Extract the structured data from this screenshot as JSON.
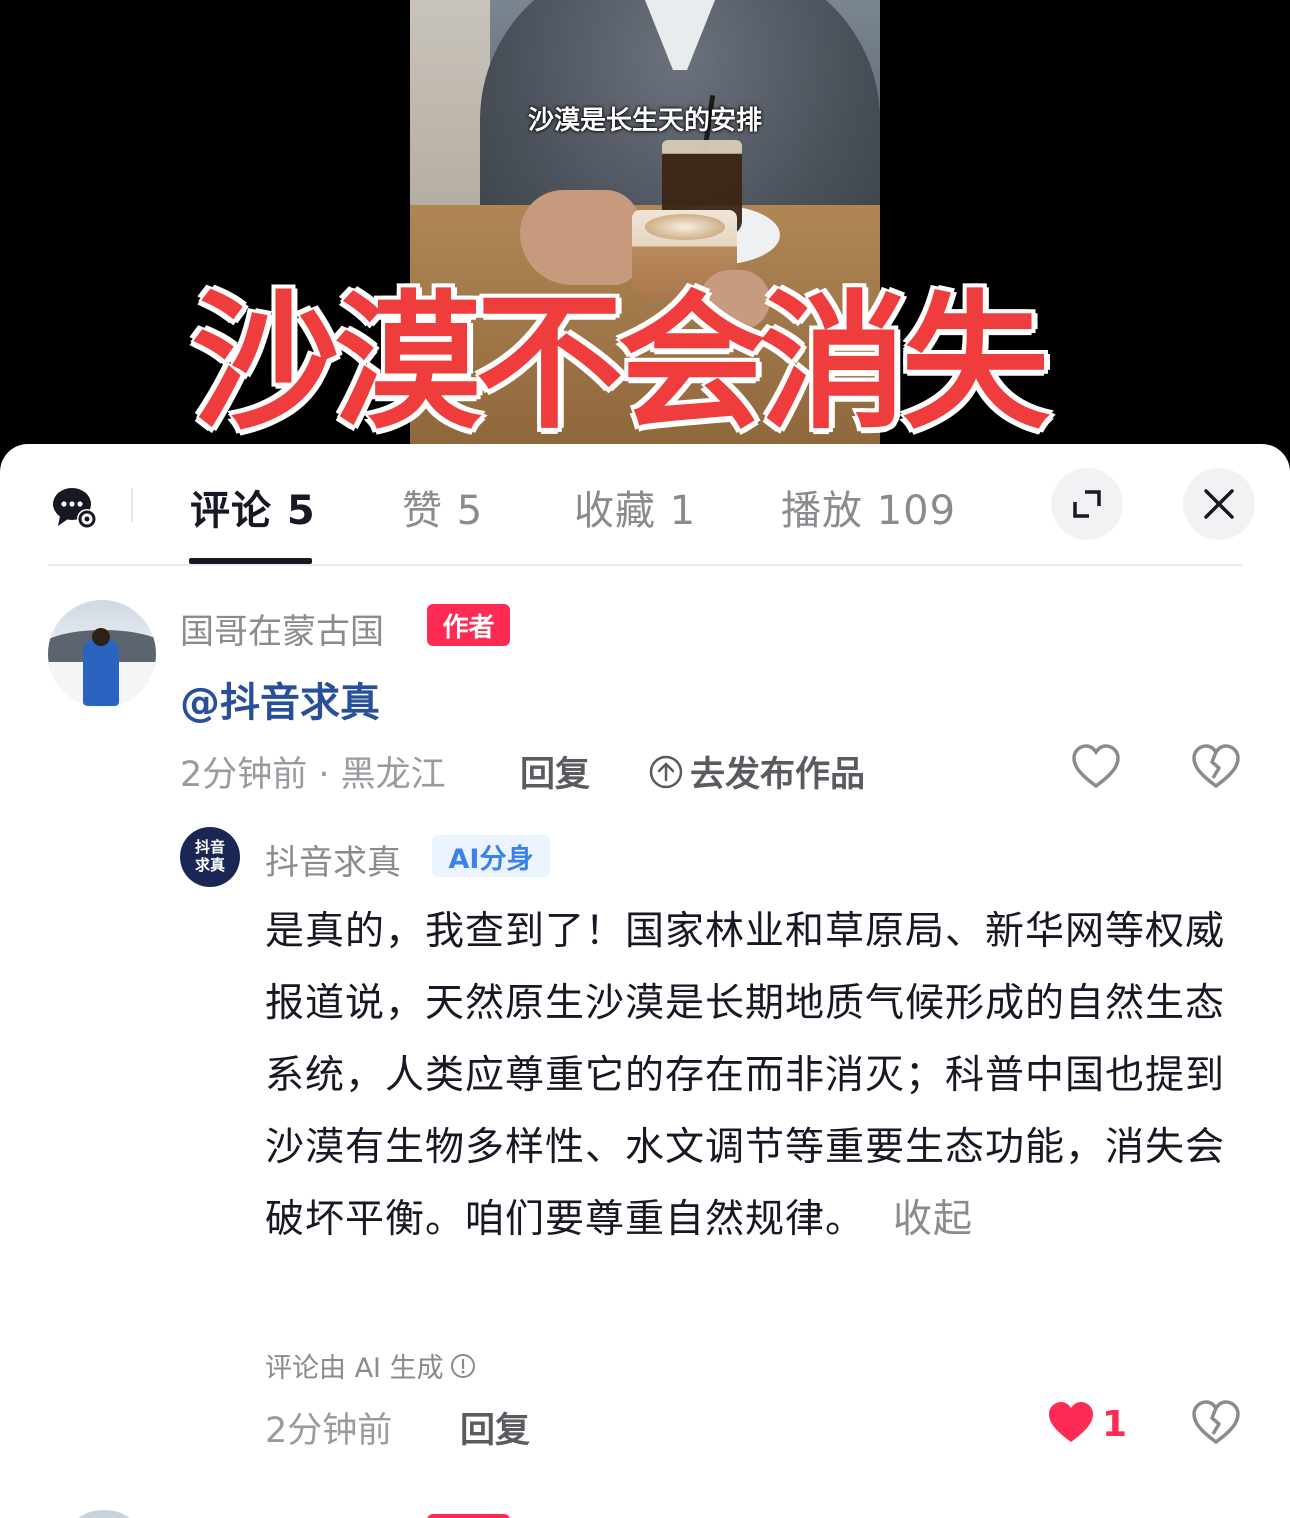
{
  "video": {
    "subtitle": "沙漠是长生天的安排",
    "overlay_title": "沙漠不会消失"
  },
  "tabs": {
    "comments": "评论 5",
    "likes": "赞 5",
    "favorites": "收藏 1",
    "plays": "播放 109"
  },
  "icons": {
    "chat": "chat-settings-icon",
    "expand": "expand-icon",
    "close": "close-icon",
    "heart": "heart-icon",
    "dislike": "broken-heart-icon",
    "upload": "upload-circle-icon",
    "info": "info-icon"
  },
  "colors": {
    "accent": "#fe2c55",
    "mention": "#2a4f9a",
    "ai_badge": "#3b82e8",
    "title_red": "#ef3c3c"
  },
  "comments": [
    {
      "username": "国哥在蒙古国",
      "badge": "作者",
      "text": "@抖音求真",
      "time_location": "2分钟前 · 黑龙江",
      "reply_label": "回复",
      "publish_label": "去发布作品"
    },
    {
      "avatar_text": "抖音求真",
      "username": "抖音求真",
      "badge": "AI分身",
      "text": "是真的，我查到了！国家林业和草原局、新华网等权威报道说，天然原生沙漠是长期地质气候形成的自然生态系统，人类应尊重它的存在而非消灭；科普中国也提到沙漠有生物多样性、水文调节等重要生态功能，消失会破坏平衡。咱们要尊重自然规律。",
      "collapse_label": "收起",
      "ai_note": "评论由 AI 生成",
      "time": "2分钟前",
      "reply_label": "回复",
      "like_count": "1",
      "liked": true
    }
  ]
}
